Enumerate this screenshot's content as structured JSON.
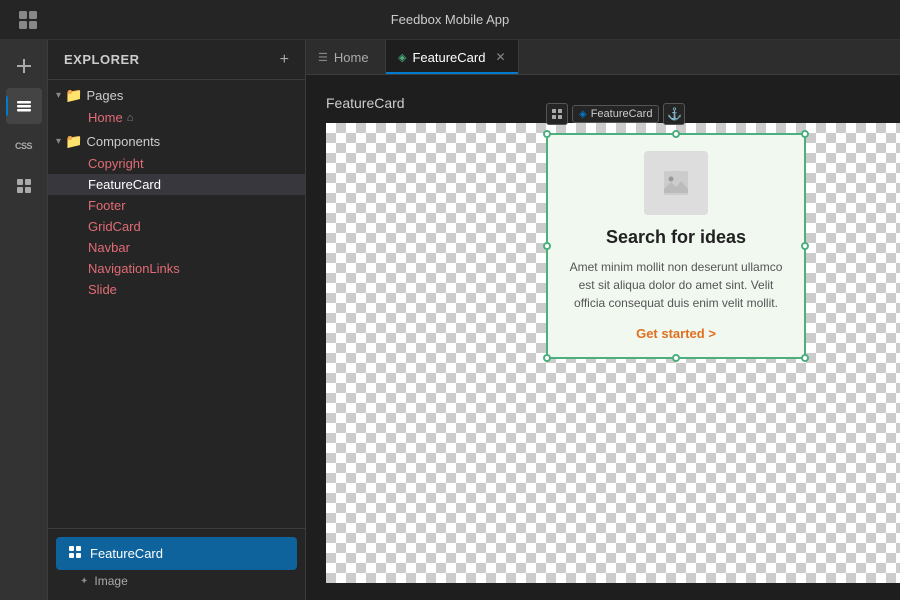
{
  "app": {
    "title": "Feedbox Mobile App",
    "logo_icon": "◈"
  },
  "topbar": {
    "title": "Feedbox Mobile App"
  },
  "icon_bar": {
    "items": [
      {
        "name": "add-icon",
        "icon": "⊕",
        "active": false
      },
      {
        "name": "layers-icon",
        "icon": "◧",
        "active": true
      },
      {
        "name": "css-icon",
        "icon": "CSS",
        "active": false
      },
      {
        "name": "image-icon",
        "icon": "⬚",
        "active": false
      }
    ]
  },
  "sidebar": {
    "title": "Explorer",
    "add_label": "+",
    "pages_folder": "Pages",
    "pages_items": [
      {
        "label": "Home",
        "has_home_icon": true
      }
    ],
    "components_folder": "Components",
    "components_items": [
      {
        "label": "Copyright",
        "active": false
      },
      {
        "label": "FeatureCard",
        "active": true
      },
      {
        "label": "Footer",
        "active": false
      },
      {
        "label": "GridCard",
        "active": false
      },
      {
        "label": "Navbar",
        "active": false
      },
      {
        "label": "NavigationLinks",
        "active": false
      },
      {
        "label": "Slide",
        "active": false
      }
    ],
    "active_component_label": "FeatureCard",
    "sub_items": [
      {
        "label": "Image",
        "icon": "✦"
      }
    ]
  },
  "tabs": [
    {
      "label": "Home",
      "icon": "☰",
      "active": false,
      "closeable": false
    },
    {
      "label": "FeatureCard",
      "icon": "◈",
      "active": true,
      "closeable": true
    }
  ],
  "canvas": {
    "title": "FeatureCard",
    "component_toolbar": {
      "grid_icon": "⊞",
      "label": "FeatureCard",
      "link_icon": "⚓"
    },
    "feature_card": {
      "image_placeholder_icon": "🖼",
      "title": "Search for ideas",
      "body": "Amet minim mollit non deserunt ullamco est sit aliqua dolor do amet sint. Velit officia consequat duis enim velit mollit.",
      "link_label": "Get started >"
    }
  }
}
